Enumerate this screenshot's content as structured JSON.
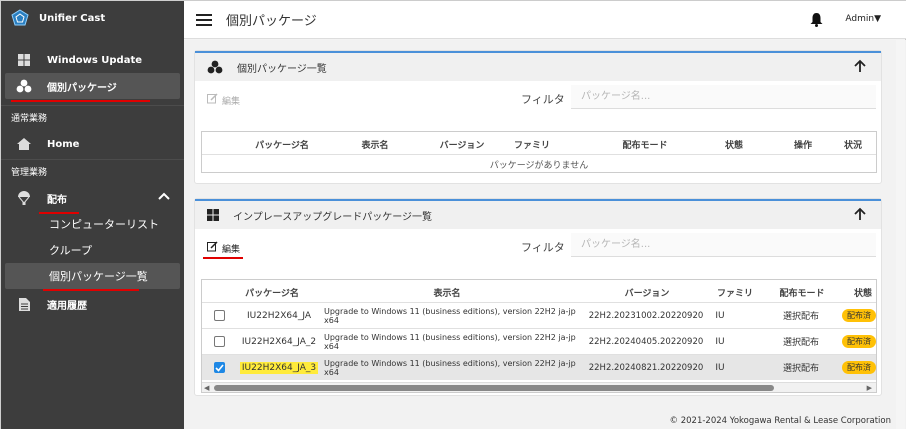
{
  "app": {
    "name": "Unifier Cast"
  },
  "sidebar": {
    "items": [
      {
        "label": "Windows Update"
      },
      {
        "label": "個別パッケージ"
      }
    ],
    "section_ops": "通常業務",
    "home": "Home",
    "section_admin": "管理業務",
    "distribution": "配布",
    "sub": [
      "コンピューターリスト",
      "クループ",
      "個別パッケージ一覧"
    ],
    "history": "適用履歴"
  },
  "topbar": {
    "title": "個別パッケージ",
    "user": "Admin▼"
  },
  "card1": {
    "title": "個別パッケージ一覧",
    "edit": "編集",
    "filter_label": "フィルタ",
    "filter_placeholder": "パッケージ名...",
    "columns": [
      "パッケージ名",
      "表示名",
      "バージョン",
      "ファミリ",
      "配布モード",
      "状態",
      "操作",
      "状況"
    ],
    "empty": "パッケージがありません"
  },
  "card2": {
    "title": "インプレースアップグレードパッケージ一覧",
    "edit": "編集",
    "filter_label": "フィルタ",
    "filter_placeholder": "パッケージ名...",
    "columns": [
      "パッケージ名",
      "表示名",
      "バージョン",
      "ファミリ",
      "配布モード",
      "状態"
    ],
    "rows": [
      {
        "checked": false,
        "name": "IU22H2X64_JA",
        "display": "Upgrade to Windows 11 (business editions), version 22H2 ja-jp x64",
        "version": "22H2.20231002.20220920",
        "family": "IU",
        "mode": "選択配布",
        "status": "配布済"
      },
      {
        "checked": false,
        "name": "IU22H2X64_JA_2",
        "display": "Upgrade to Windows 11 (business editions), version 22H2 ja-jp x64",
        "version": "22H2.20240405.20220920",
        "family": "IU",
        "mode": "選択配布",
        "status": "配布済"
      },
      {
        "checked": true,
        "name": "IU22H2X64_JA_3",
        "display": "Upgrade to Windows 11 (business editions), version 22H2 ja-jp x64",
        "version": "22H2.20240821.20220920",
        "family": "IU",
        "mode": "選択配布",
        "status": "配布済"
      }
    ]
  },
  "footer": "© 2021-2024 Yokogawa Rental & Lease Corporation",
  "colors": {
    "sidebar": "#3d3d3d",
    "accent": "#4a90d9",
    "underline": "#e00000",
    "badge": "#ffc107",
    "highlight": "#ffeb3b"
  }
}
